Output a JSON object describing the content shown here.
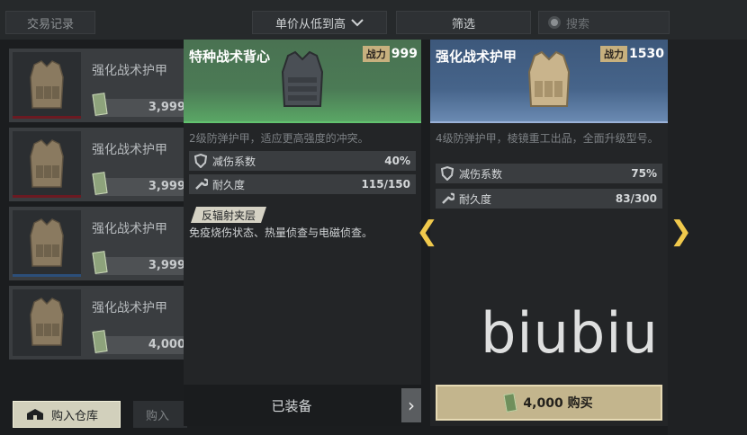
{
  "topbar": {
    "history_label": "交易记录",
    "sort_label": "单价从低到高",
    "filter_label": "筛选",
    "search_placeholder": "搜索"
  },
  "list": {
    "items": [
      {
        "name": "强化战术护甲",
        "price": "3,999",
        "accent": "#6b1a22"
      },
      {
        "name": "强化战术护甲",
        "price": "3,999",
        "accent": "#6b1a22"
      },
      {
        "name": "强化战术护甲",
        "price": "3,999",
        "accent": "#2c4f7a"
      },
      {
        "name": "强化战术护甲",
        "price": "4,000",
        "accent": "#2b2e31"
      }
    ]
  },
  "bottom": {
    "move_label": "购入仓库",
    "buy_to_label": "购入"
  },
  "left_panel": {
    "title": "特种战术背心",
    "power_label": "战力",
    "power_value": "999",
    "description": "2级防弹护甲，适应更高强度的冲突。",
    "stats": [
      {
        "label": "减伤系数",
        "value": "40%"
      },
      {
        "label": "耐久度",
        "value": "115/150"
      }
    ],
    "perk_name": "反辐射夹层",
    "perk_desc": "免疫烧伤状态、热量侦查与电磁侦查。",
    "equipped_label": "已装备"
  },
  "right_panel": {
    "title": "强化战术护甲",
    "power_label": "战力",
    "power_value": "1530",
    "description": "4级防弹护甲，棱镜重工出品，全面升级型号。",
    "stats": [
      {
        "label": "减伤系数",
        "value": "75%"
      },
      {
        "label": "耐久度",
        "value": "83/300"
      }
    ],
    "buy_label": "4,000 购买"
  },
  "watermark": "biubiu",
  "colors": {
    "left_header": "#4b7a55",
    "right_header": "#46648a",
    "gold_accent": "#f0c94c"
  }
}
